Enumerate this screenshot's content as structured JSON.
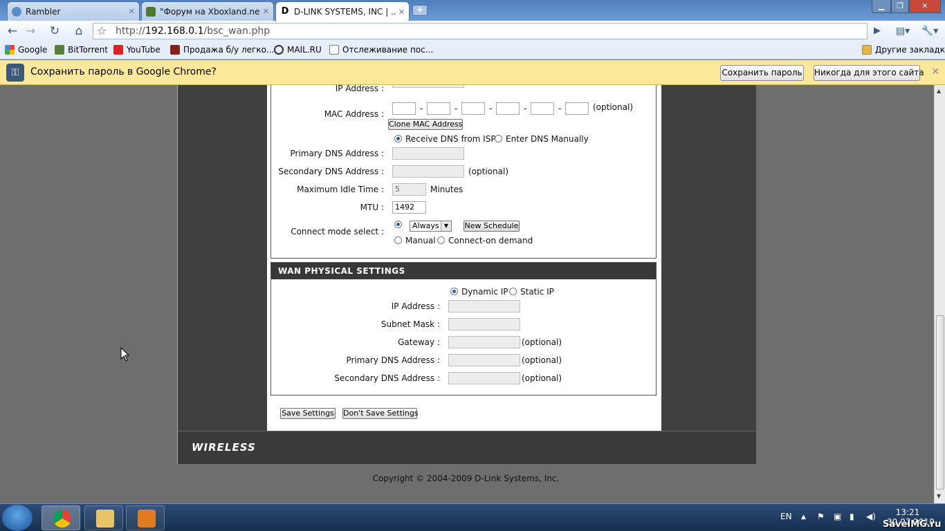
{
  "browser": {
    "tabs": [
      {
        "title": "Rambler",
        "icon": "rambler-icon",
        "active": false
      },
      {
        "title": "\"Форум на Xboxland.net...",
        "icon": "xboxland-icon",
        "active": false
      },
      {
        "title": "D-LINK SYSTEMS, INC | ...",
        "icon": "dlink-icon",
        "active": true
      }
    ],
    "new_tab_label": "+",
    "address": {
      "prefix": "http://",
      "host": "192.168.0.1",
      "path": "/bsc_wan.php"
    },
    "bookmarks": [
      {
        "label": "Google"
      },
      {
        "label": "BitTorrent"
      },
      {
        "label": "YouTube"
      },
      {
        "label": "Продажа б/у легко..."
      },
      {
        "label": "MAIL.RU"
      },
      {
        "label": "Отслеживание пос..."
      }
    ],
    "other_bookmarks": "Другие закладки",
    "infobar": {
      "message": "Сохранить пароль в Google Chrome?",
      "save_button": "Сохранить пароль",
      "never_button": "Никогда для этого сайта",
      "close": "✕"
    }
  },
  "router": {
    "connection": {
      "ip_label": "IP Address :",
      "mac_label": "MAC Address :",
      "mac_optional": "(optional)",
      "mac_sep": "-",
      "clone_button": "Clone MAC Address",
      "dns_receive": "Receive DNS from ISP",
      "dns_manual": "Enter DNS Manually",
      "primary_dns_label": "Primary DNS Address :",
      "secondary_dns_label": "Secondary DNS Address :",
      "secondary_dns_optional": "(optional)",
      "idle_label": "Maximum Idle Time :",
      "idle_value": "5",
      "idle_unit": "Minutes",
      "mtu_label": "MTU :",
      "mtu_value": "1492",
      "connect_label": "Connect mode select :",
      "schedule_value": "Always",
      "new_schedule_button": "New Schedule",
      "manual_label": "Manual",
      "on_demand_label": "Connect-on demand"
    },
    "wan_physical": {
      "heading": "WAN PHYSICAL SETTINGS",
      "dynamic_label": "Dynamic IP",
      "static_label": "Static IP",
      "ip_label": "IP Address :",
      "subnet_label": "Subnet Mask :",
      "gateway_label": "Gateway :",
      "primary_dns_label": "Primary DNS Address :",
      "secondary_dns_label": "Secondary DNS Address :",
      "optional": "(optional)"
    },
    "save_button": "Save Settings",
    "dont_save_button": "Don't Save Settings",
    "footer_logo": "WIRELESS",
    "copyright": "Copyright © 2004-2009 D-Link Systems, Inc."
  },
  "taskbar": {
    "language": "EN",
    "time": "13:21",
    "date": "30.07.2010"
  },
  "watermark": "SaveIMG.ru",
  "colors": {
    "infobar": "#fbe89a",
    "router_frame": "#3c3c3c",
    "section_header": "#383838",
    "page_bg": "#6e6e6e"
  }
}
